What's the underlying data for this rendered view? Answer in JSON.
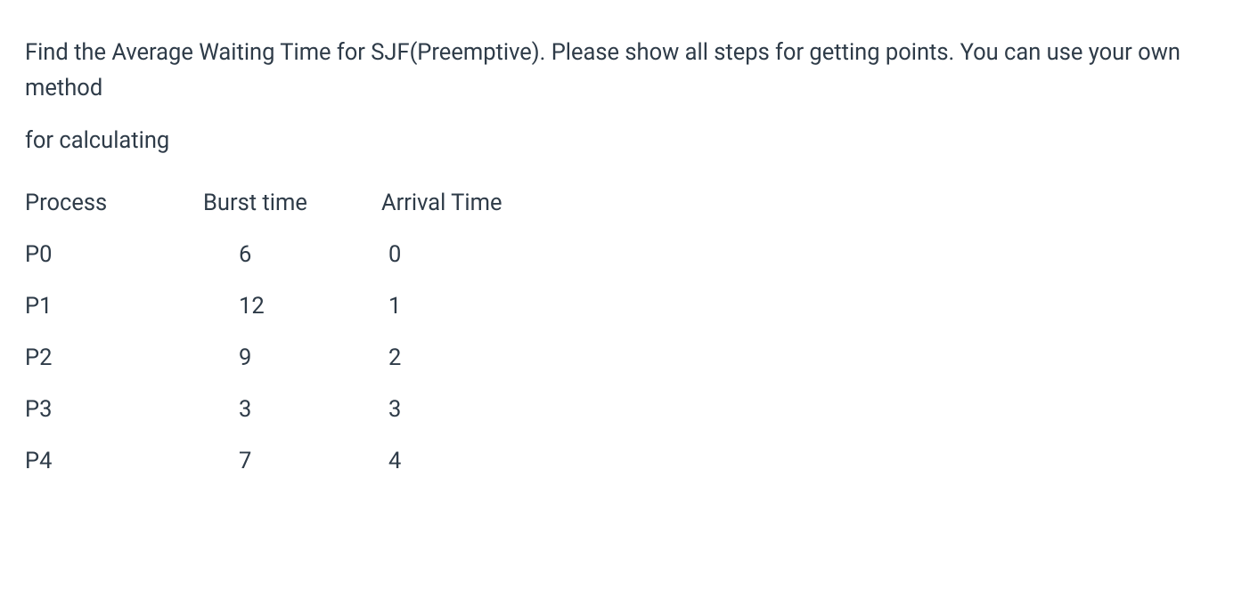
{
  "question": {
    "line1": "Find the Average Waiting Time for SJF(Preemptive).  Please show all steps for getting points. You can use your own method",
    "line2": "for calculating"
  },
  "table": {
    "headers": {
      "process": "Process",
      "burst": "Burst time",
      "arrival": "Arrival Time"
    },
    "rows": [
      {
        "process": "P0",
        "burst": "6",
        "arrival": "0"
      },
      {
        "process": "P1",
        "burst": "12",
        "arrival": "1"
      },
      {
        "process": "P2",
        "burst": "9",
        "arrival": "2"
      },
      {
        "process": "P3",
        "burst": "3",
        "arrival": "3"
      },
      {
        "process": "P4",
        "burst": "7",
        "arrival": "4"
      }
    ]
  }
}
